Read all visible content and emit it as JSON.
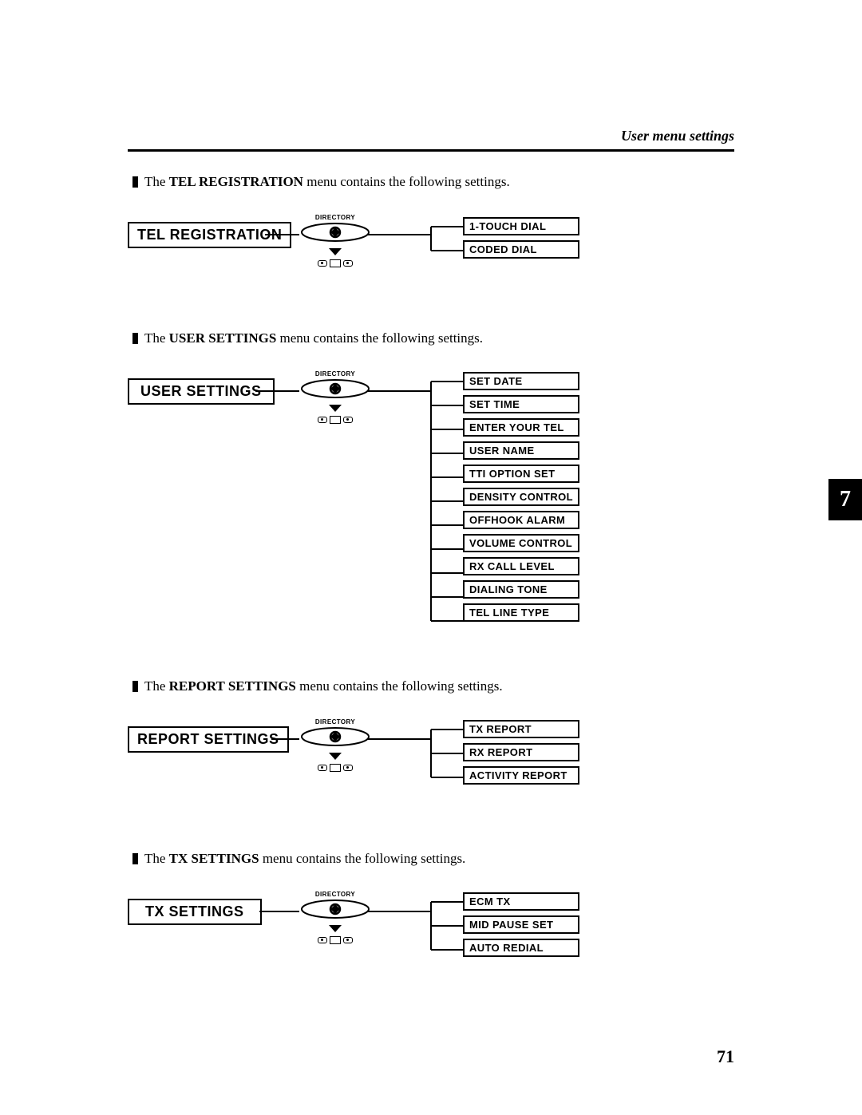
{
  "header": {
    "title": "User menu settings"
  },
  "side_tab": "7",
  "page_number": "71",
  "sections": [
    {
      "intro_prefix": "The ",
      "intro_bold": "TEL REGISTRATION",
      "intro_suffix": " menu contains the following settings.",
      "menu_label": "TEL REGISTRATION",
      "nav_top": "DIRECTORY",
      "options": [
        "1-TOUCH DIAL",
        "CODED DIAL"
      ]
    },
    {
      "intro_prefix": "The ",
      "intro_bold": "USER SETTINGS",
      "intro_suffix": " menu contains the following settings.",
      "menu_label": "USER SETTINGS",
      "nav_top": "DIRECTORY",
      "options": [
        "SET DATE",
        "SET TIME",
        "ENTER YOUR TEL",
        "USER NAME",
        "TTI OPTION SET",
        "DENSITY CONTROL",
        "OFFHOOK ALARM",
        "VOLUME CONTROL",
        "RX CALL LEVEL",
        "DIALING TONE",
        "TEL LINE TYPE"
      ]
    },
    {
      "intro_prefix": "The ",
      "intro_bold": "REPORT SETTINGS",
      "intro_suffix": " menu contains the following settings.",
      "menu_label": "REPORT SETTINGS",
      "nav_top": "DIRECTORY",
      "options": [
        "TX REPORT",
        "RX REPORT",
        "ACTIVITY REPORT"
      ]
    },
    {
      "intro_prefix": "The ",
      "intro_bold": "TX SETTINGS",
      "intro_suffix": " menu contains the following settings.",
      "menu_label": "TX SETTINGS",
      "nav_top": "DIRECTORY",
      "options": [
        "ECM TX",
        "MID PAUSE SET",
        "AUTO REDIAL"
      ]
    }
  ]
}
